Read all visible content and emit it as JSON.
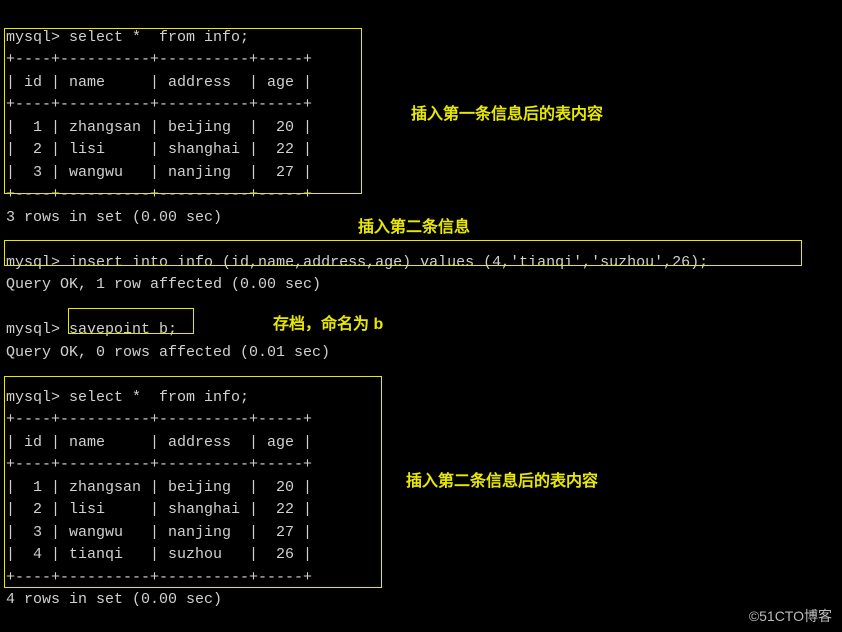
{
  "prompt": "mysql>",
  "query1": "select *  from info;",
  "table1": {
    "div": "+----+----------+----------+-----+",
    "header": "| id | name     | address  | age |",
    "rows": [
      "|  1 | zhangsan | beijing  |  20 |",
      "|  2 | lisi     | shanghai |  22 |",
      "|  3 | wangwu   | nanjing  |  27 |"
    ],
    "status": "3 rows in set (0.00 sec)"
  },
  "insert_cmd": "insert into info (id,name,address,age) values (4,'tianqi','suzhou',26);",
  "insert_status": "Query OK, 1 row affected (0.00 sec)",
  "savepoint_cmd": "savepoint b;",
  "savepoint_status": "Query OK, 0 rows affected (0.01 sec)",
  "query2": "select *  from info;",
  "table2": {
    "div": "+----+----------+----------+-----+",
    "header": "| id | name     | address  | age |",
    "rows": [
      "|  1 | zhangsan | beijing  |  20 |",
      "|  2 | lisi     | shanghai |  22 |",
      "|  3 | wangwu   | nanjing  |  27 |",
      "|  4 | tianqi   | suzhou   |  26 |"
    ],
    "status": "4 rows in set (0.00 sec)"
  },
  "annotations": {
    "a1": "插入第一条信息后的表内容",
    "a2": "插入第二条信息",
    "a3": "存档，命名为 b",
    "a4": "插入第二条信息后的表内容"
  },
  "watermark": "©51CTO博客",
  "chart_data": {
    "type": "table",
    "tables": [
      {
        "title": "info (after first insert)",
        "columns": [
          "id",
          "name",
          "address",
          "age"
        ],
        "rows": [
          [
            1,
            "zhangsan",
            "beijing",
            20
          ],
          [
            2,
            "lisi",
            "shanghai",
            22
          ],
          [
            3,
            "wangwu",
            "nanjing",
            27
          ]
        ]
      },
      {
        "title": "info (after second insert)",
        "columns": [
          "id",
          "name",
          "address",
          "age"
        ],
        "rows": [
          [
            1,
            "zhangsan",
            "beijing",
            20
          ],
          [
            2,
            "lisi",
            "shanghai",
            22
          ],
          [
            3,
            "wangwu",
            "nanjing",
            27
          ],
          [
            4,
            "tianqi",
            "suzhou",
            26
          ]
        ]
      }
    ]
  }
}
